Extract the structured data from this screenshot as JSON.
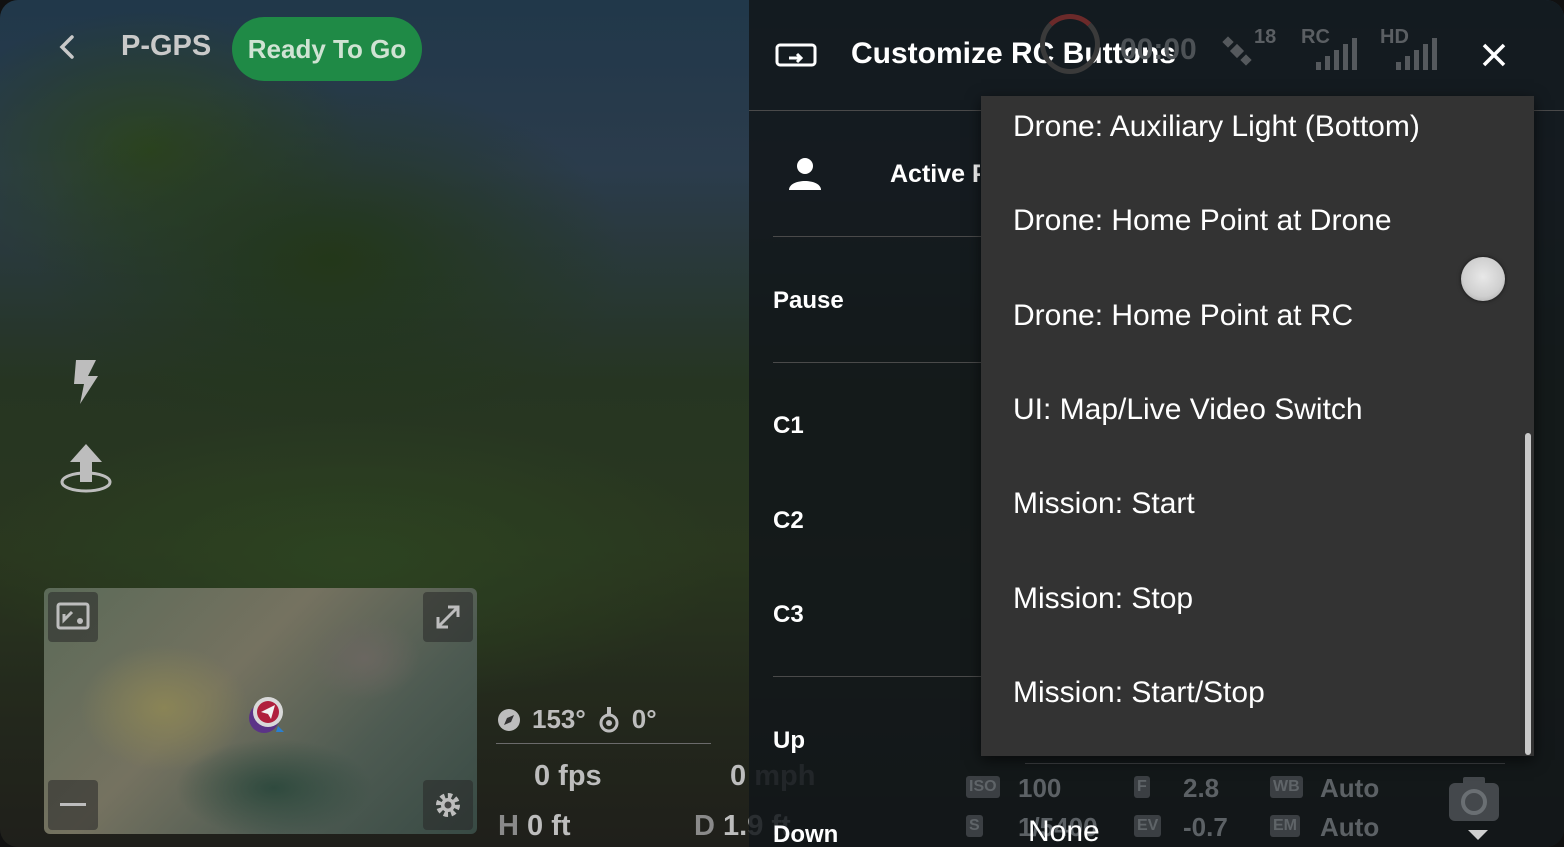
{
  "hud": {
    "mode": "P-GPS",
    "status": "Ready To Go",
    "heading": "153°",
    "gimbal_angle": "0°",
    "fps": "0 fps",
    "speed_value": "0",
    "speed_unit": "mph",
    "height_label": "H",
    "height_value": "0 ft",
    "distance_label": "D",
    "distance_value": "1.9 ft",
    "timer": "00:00",
    "satellites": "18",
    "rc_label": "RC",
    "hd_label": "HD"
  },
  "panel": {
    "title": "Customize RC Buttons",
    "active_label": "Active P",
    "rows": [
      "Pause",
      "C1",
      "C2",
      "C3",
      "Up",
      "Down"
    ]
  },
  "dropdown": {
    "items": [
      "Drone: Auxiliary Light (Bottom)",
      "Drone: Home Point at Drone",
      "Drone: Home Point at RC",
      "UI: Map/Live Video Switch",
      "Mission: Start",
      "Mission: Stop",
      "Mission: Start/Stop"
    ]
  },
  "camera": {
    "iso_badge": "ISO",
    "iso": "100",
    "f_badge": "F",
    "aperture": "2.8",
    "wb_badge": "WB",
    "wb": "Auto",
    "s_badge": "S",
    "shutter": "1/5400",
    "ev_badge": "EV",
    "ev": "-0.7",
    "em_badge": "EM",
    "em": "Auto",
    "selected_value": "None"
  },
  "colors": {
    "status_green": "#1f8a46",
    "dropdown_bg": "#333333",
    "panel_bg": "#12161a"
  }
}
